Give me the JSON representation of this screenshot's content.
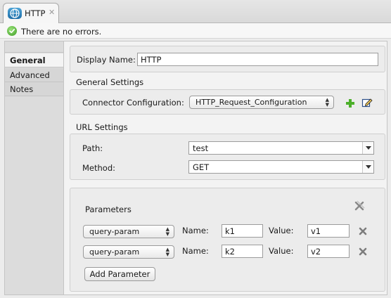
{
  "tab": {
    "title": "HTTP",
    "close": "✕"
  },
  "status": {
    "text": "There are no errors."
  },
  "sidebar": {
    "items": [
      {
        "label": "General"
      },
      {
        "label": "Advanced"
      },
      {
        "label": "Notes"
      }
    ]
  },
  "form": {
    "display_name_label": "Display Name:",
    "display_name_value": "HTTP",
    "general_settings": {
      "title": "General Settings",
      "connector_label": "Connector Configuration:",
      "connector_value": "HTTP_Request_Configuration"
    },
    "url_settings": {
      "title": "URL Settings",
      "path_label": "Path:",
      "path_value": "test",
      "method_label": "Method:",
      "method_value": "GET"
    },
    "parameters": {
      "title": "Parameters",
      "rows": [
        {
          "type": "query-param",
          "name_label": "Name:",
          "name": "k1",
          "value_label": "Value:",
          "value": "v1"
        },
        {
          "type": "query-param",
          "name_label": "Name:",
          "name": "k2",
          "value_label": "Value:",
          "value": "v2"
        }
      ],
      "add_label": "Add Parameter"
    }
  },
  "icons": {
    "tab": "globe-icon",
    "status": "check-circle-icon",
    "add_config": "plus-icon",
    "edit_config": "edit-icon",
    "remove_all": "remove-all-icon",
    "remove_row": "x-icon"
  },
  "colors": {
    "success": "#3c9c24",
    "plus": "#4caf2a",
    "globe": "#1e6ea8"
  }
}
